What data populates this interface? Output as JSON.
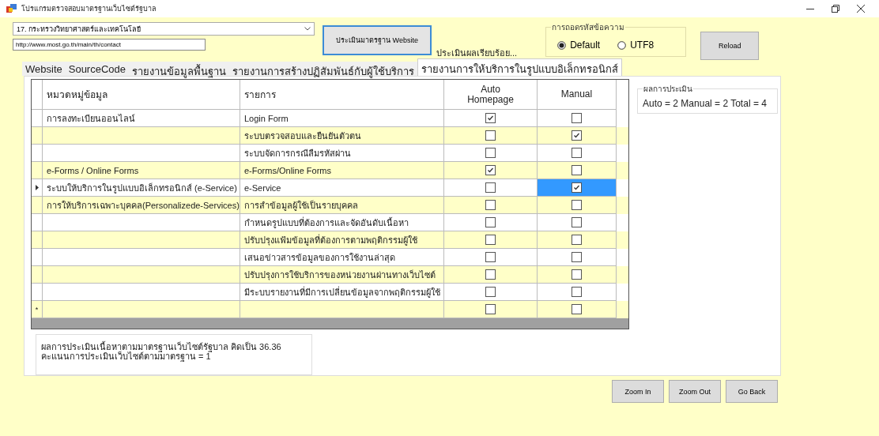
{
  "window": {
    "title": "โปรแกรมตรวจสอบมาตรฐานเว็บไซต์รัฐบาล"
  },
  "agency_select": {
    "value": "17. กระทรวงวิทยาศาสตร์และเทคโนโลยี"
  },
  "url_field": {
    "value": "http://www.most.go.th/main/th/contact"
  },
  "evaluate_button": "ประเมินมาตรฐาน Website",
  "status": "ประเมินผลเรียบร้อย...",
  "encoding": {
    "title": "การถอดรหัสข้อความ",
    "options": [
      {
        "label": "Default",
        "selected": true
      },
      {
        "label": "UTF8",
        "selected": false
      }
    ]
  },
  "reload_button": "Reload",
  "tabs": [
    {
      "label": "Website",
      "selected": false
    },
    {
      "label": "SourceCode",
      "selected": false
    },
    {
      "label": "รายงานข้อมูลพื้นฐาน",
      "selected": false
    },
    {
      "label": "รายงานการสร้างปฏิสัมพันธ์กับผู้ใช้บริการ",
      "selected": false
    },
    {
      "label": "รายงานการให้บริการในรูปแบบอิเล็กทรอนิกส์",
      "selected": true
    }
  ],
  "table": {
    "columns": [
      "หมวดหมู่ข้อมูล",
      "รายการ",
      "Auto Homepage",
      "Manual"
    ],
    "rows": [
      {
        "category": "การลงทะเบียนออนไลน์",
        "item": "Login Form",
        "auto": true,
        "manual": false,
        "selected": false
      },
      {
        "item": "ระบบตรวจสอบและยืนยันตัวตน",
        "auto": false,
        "manual": true,
        "selected": false
      },
      {
        "item": "ระบบจัดการกรณีลืมรหัสผ่าน",
        "auto": false,
        "manual": false,
        "selected": false
      },
      {
        "category": "e-Forms / Online Forms",
        "item": "e-Forms/Online Forms",
        "auto": true,
        "manual": false,
        "selected": false
      },
      {
        "category": "ระบบให้บริการในรูปแบบอิเล็กทรอนิกส์ (e-Service)",
        "item": "e-Service",
        "auto": false,
        "manual": true,
        "selected": true
      },
      {
        "category": "การให้บริการเฉพาะบุคคล(Personalizede-Services)",
        "item": "การสำข้อมูลผู้ใช้เป็นรายบุคคล",
        "auto": false,
        "manual": false,
        "selected": false
      },
      {
        "item": "กำหนดรูปแบบที่ต้องการและจัดอันดับเนื้อหา",
        "auto": false,
        "manual": false,
        "selected": false
      },
      {
        "item": "ปรับปรุงแฟ้มข้อมูลที่ต้องการตามพฤติกรรมผู้ใช้",
        "auto": false,
        "manual": false,
        "selected": false
      },
      {
        "item": "เสนอข่าวสารข้อมูลของการใช้งานล่าสุด",
        "auto": false,
        "manual": false,
        "selected": false
      },
      {
        "item": "ปรับปรุงการใช้บริการของหน่วยงานผ่านทางเว็บไซต์",
        "auto": false,
        "manual": false,
        "selected": false
      },
      {
        "item": "มีระบบรายงานที่มีการเปลี่ยนข้อมูลจากพฤติกรรมผู้ใช้",
        "auto": false,
        "manual": false,
        "selected": false
      }
    ],
    "new_row": {
      "marker": "*",
      "auto": false,
      "manual": false
    }
  },
  "results": {
    "title": "ผลการประเมิน",
    "text": "Auto = 2 Manual = 2 Total = 4"
  },
  "summary": [
    "ผลการประเมินเนื้อหาตามมาตรฐานเว็บไซต์รัฐบาล คิดเป็น  36.36",
    "คะแนนการประเมินเว็บไซต์ตามมาตรฐาน = 1"
  ],
  "bottom_buttons": [
    "Zoom In",
    "Zoom Out",
    "Go Back"
  ]
}
